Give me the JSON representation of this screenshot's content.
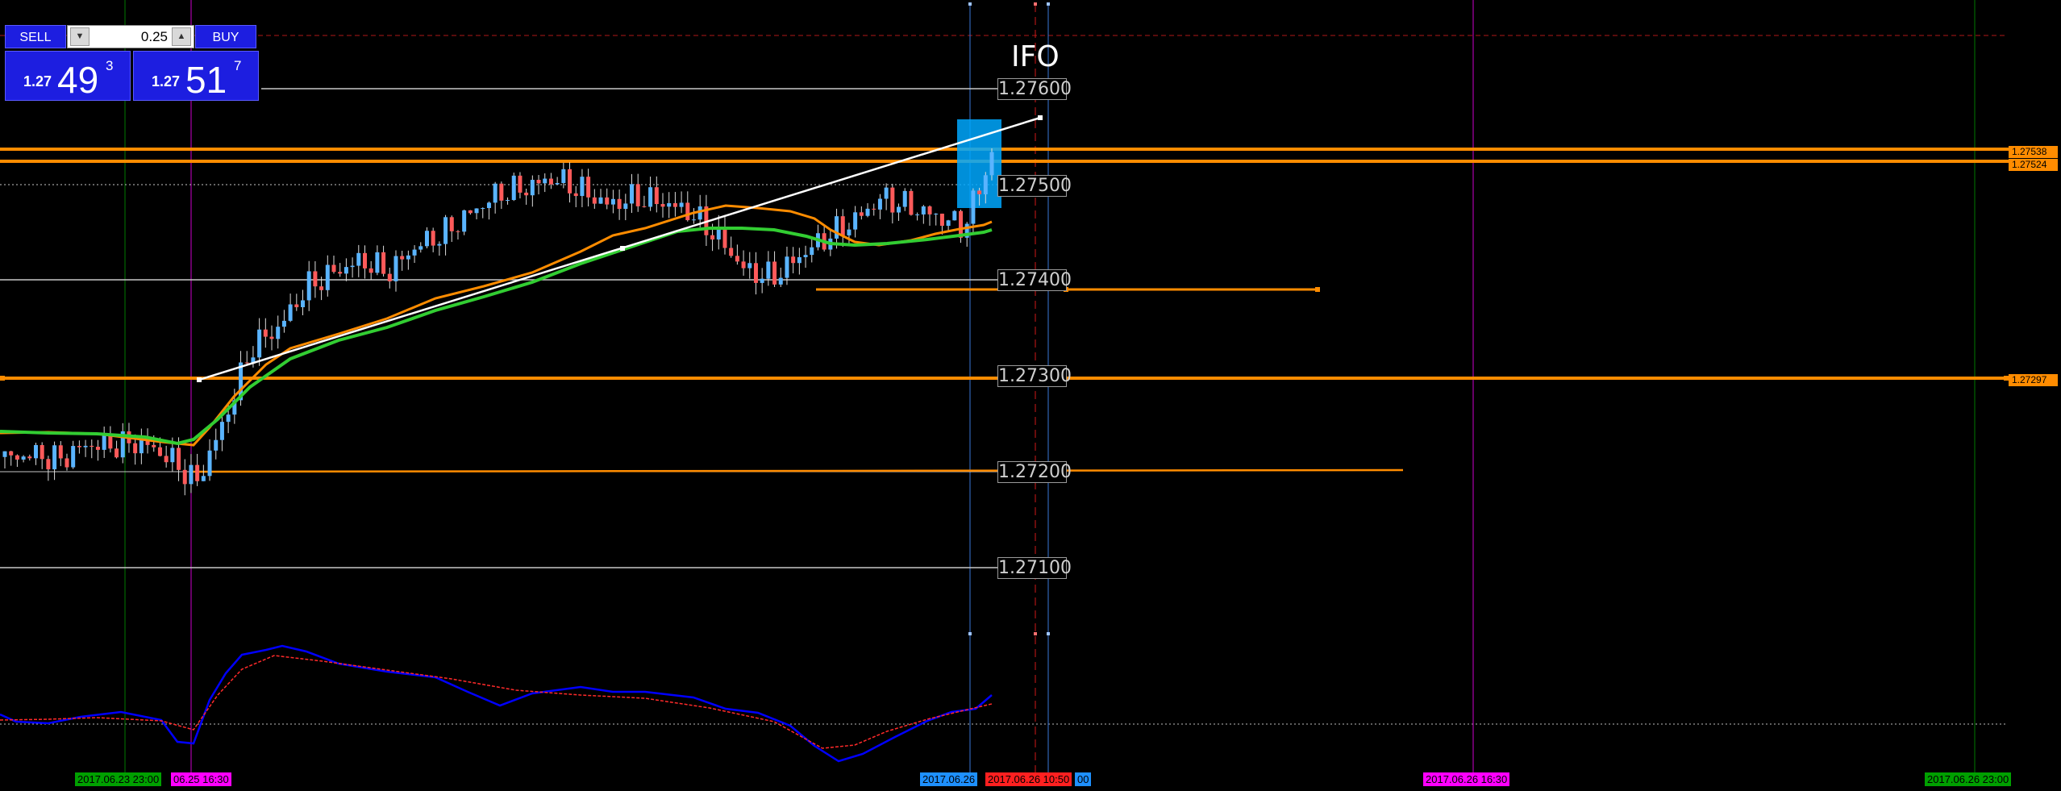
{
  "trade_panel": {
    "sell_label": "SELL",
    "buy_label": "BUY",
    "lot_size": "0.25",
    "spin_down_icon": "triangle-down",
    "spin_up_icon": "triangle-up",
    "sell": {
      "prefix": "1.27",
      "big": "49",
      "sup": "3"
    },
    "buy": {
      "prefix": "1.27",
      "big": "51",
      "sup": "7"
    }
  },
  "chart_title": "IFO",
  "line_labels": {
    "p27600": "1.27600",
    "p27500": "1.27500",
    "p27400": "1.27400",
    "p27300": "1.27300",
    "p27200": "1.27200",
    "p27100": "1.27100"
  },
  "price_tags": {
    "t27538": "1.27538",
    "t27524": "1.27524",
    "t27297": "1.27297"
  },
  "time_tags": {
    "t1": "2017.06.23 23:00",
    "t2": "06.25 16:30",
    "t3": "2017.06.26",
    "t4": "2017.06.26 10:50",
    "t5": "00",
    "t6": "2017.06.26 16:30",
    "t7": "2017.06.26 23:00"
  },
  "colors": {
    "background": "#000000",
    "orange": "#ff8c00",
    "green_ma": "#32cd32",
    "white": "#ffffff",
    "bull": "#5ab4ff",
    "bear": "#ff5a5a",
    "oscillator": "#0000ff",
    "signal": "#ff2a2a",
    "magenta": "#ff00ff",
    "sky": "#1e90ff",
    "dark_green": "#007a00",
    "deep_sky": "#00bfff"
  },
  "chart_data": {
    "type": "candlestick",
    "symbol": "",
    "y_axis_labels": [
      "1.27100",
      "1.27200",
      "1.27300",
      "1.27400",
      "1.27500",
      "1.27600"
    ],
    "horizontal_levels": [
      1.27538,
      1.27524,
      1.27297
    ],
    "grid_levels": [
      1.276,
      1.275,
      1.274,
      1.273,
      1.272,
      1.271
    ],
    "short_levels": [
      1.27399,
      1.27201
    ],
    "ohlc_close_path": [
      [
        1.27215,
        1.27213
      ],
      [
        1.27224,
        1.27218
      ],
      [
        1.2721,
        1.27212
      ],
      [
        1.27214,
        1.27228
      ],
      [
        1.27226,
        1.27227
      ],
      [
        1.27229,
        1.2723
      ],
      [
        1.27218,
        1.27214
      ],
      [
        1.27205,
        1.27188
      ],
      [
        1.27196,
        1.27252
      ],
      [
        1.27262,
        1.2733
      ],
      [
        1.2734,
        1.2735
      ],
      [
        1.27362,
        1.27392
      ],
      [
        1.27402,
        1.27408
      ],
      [
        1.27412,
        1.2742
      ],
      [
        1.27425,
        1.27408
      ],
      [
        1.27418,
        1.27435
      ],
      [
        1.27442,
        1.27448
      ],
      [
        1.27455,
        1.2747
      ],
      [
        1.27478,
        1.2749
      ],
      [
        1.27488,
        1.27496
      ],
      [
        1.275,
        1.27506
      ],
      [
        1.27508,
        1.27494
      ],
      [
        1.27488,
        1.27478
      ],
      [
        1.2748,
        1.27486
      ],
      [
        1.2749,
        1.27481
      ],
      [
        1.27478,
        1.2747
      ],
      [
        1.27465,
        1.27445
      ],
      [
        1.2744,
        1.2741
      ],
      [
        1.27405,
        1.27402
      ],
      [
        1.27408,
        1.27425
      ],
      [
        1.2743,
        1.27445
      ],
      [
        1.2745,
        1.27462
      ],
      [
        1.27472,
        1.27486
      ],
      [
        1.27494,
        1.27476
      ],
      [
        1.2747,
        1.27466
      ],
      [
        1.27468,
        1.27455
      ],
      [
        1.2747,
        1.2753
      ]
    ]
  }
}
